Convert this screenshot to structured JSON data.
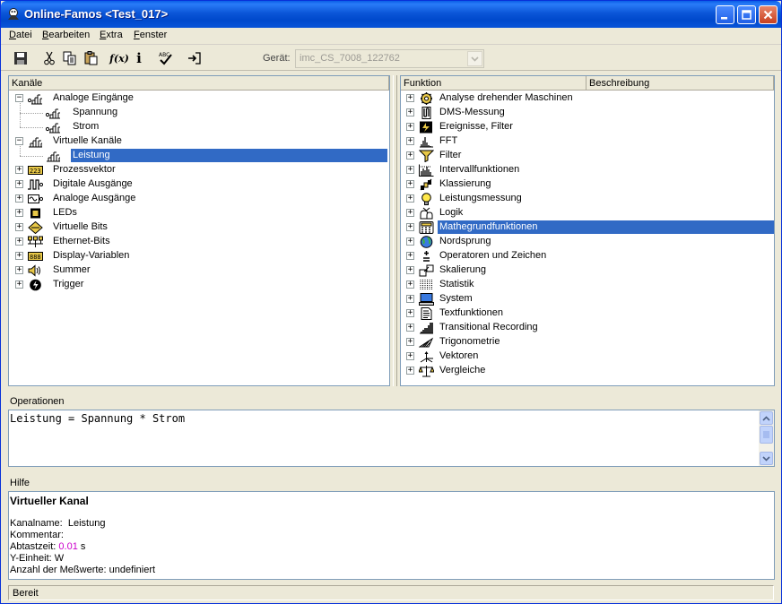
{
  "window": {
    "title": "Online-Famos <Test_017>",
    "buttons": [
      "minimize",
      "maximize",
      "close"
    ]
  },
  "menu": [
    {
      "label": "Datei",
      "u": "D",
      "rest": "atei"
    },
    {
      "label": "Bearbeiten",
      "u": "B",
      "rest": "earbeiten"
    },
    {
      "label": "Extra",
      "u": "E",
      "rest": "xtra"
    },
    {
      "label": "Fenster",
      "u": "F",
      "rest": "enster"
    }
  ],
  "toolbar": {
    "tools": [
      "save-icon",
      "cut-icon",
      "copy-icon",
      "paste-icon",
      "function-icon",
      "info-icon",
      "spellcheck-icon",
      "login-icon"
    ],
    "function_label": "f(x)",
    "info_label": "i",
    "geraet_label": "Gerät:",
    "geraet_value": "imc_CS_7008_122762"
  },
  "left_panel": {
    "header": "Kanäle",
    "items": [
      {
        "label": "Analoge Eingänge",
        "exp": "−",
        "icon": "analog-input-icon"
      },
      {
        "label": "Spannung",
        "icon": "analog-input-icon"
      },
      {
        "label": "Strom",
        "icon": "analog-input-icon"
      },
      {
        "label": "Virtuelle Kanäle",
        "exp": "−",
        "icon": "virtual-channel-icon"
      },
      {
        "label": "Leistung",
        "icon": "virtual-channel-icon",
        "selected": true
      },
      {
        "label": "Prozessvektor",
        "exp": "+",
        "icon": "process-vector-icon",
        "icon_text": "223"
      },
      {
        "label": "Digitale Ausgänge",
        "exp": "+",
        "icon": "digital-output-icon"
      },
      {
        "label": "Analoge Ausgänge",
        "exp": "+",
        "icon": "analog-output-icon"
      },
      {
        "label": "LEDs",
        "exp": "+",
        "icon": "led-icon"
      },
      {
        "label": "Virtuelle Bits",
        "exp": "+",
        "icon": "virtual-bits-icon"
      },
      {
        "label": "Ethernet-Bits",
        "exp": "+",
        "icon": "ethernet-bits-icon"
      },
      {
        "label": "Display-Variablen",
        "exp": "+",
        "icon": "display-variable-icon",
        "icon_text": "888"
      },
      {
        "label": "Summer",
        "exp": "+",
        "icon": "speaker-icon"
      },
      {
        "label": "Trigger",
        "exp": "+",
        "icon": "trigger-icon"
      }
    ]
  },
  "right_panel": {
    "headers": [
      "Funktion",
      "Beschreibung"
    ],
    "items": [
      {
        "label": "Analyse drehender Maschinen",
        "icon": "gear-icon"
      },
      {
        "label": "DMS-Messung",
        "icon": "strain-gauge-icon"
      },
      {
        "label": "Ereignisse, Filter",
        "icon": "events-icon"
      },
      {
        "label": "FFT",
        "icon": "fft-icon"
      },
      {
        "label": "Filter",
        "icon": "filter-icon"
      },
      {
        "label": "Intervallfunktionen",
        "icon": "interval-icon"
      },
      {
        "label": "Klassierung",
        "icon": "classification-icon"
      },
      {
        "label": "Leistungsmessung",
        "icon": "lightbulb-icon"
      },
      {
        "label": "Logik",
        "icon": "logic-icon"
      },
      {
        "label": "Mathegrundfunktionen",
        "icon": "calculator-icon",
        "selected": true
      },
      {
        "label": "Nordsprung",
        "icon": "globe-icon"
      },
      {
        "label": "Operatoren und Zeichen",
        "icon": "operators-icon"
      },
      {
        "label": "Skalierung",
        "icon": "scaling-icon"
      },
      {
        "label": "Statistik",
        "icon": "statistics-icon"
      },
      {
        "label": "System",
        "icon": "computer-icon"
      },
      {
        "label": "Textfunktionen",
        "icon": "document-icon"
      },
      {
        "label": "Transitional Recording",
        "icon": "recording-icon"
      },
      {
        "label": "Trigonometrie",
        "icon": "trigonometry-icon"
      },
      {
        "label": "Vektoren",
        "icon": "vectors-icon"
      },
      {
        "label": "Vergleiche",
        "icon": "scales-icon"
      }
    ]
  },
  "operations": {
    "label": "Operationen",
    "text": "Leistung = Spannung * Strom"
  },
  "help": {
    "label": "Hilfe",
    "title": "Virtueller Kanal",
    "channel_name_label": "Kanalname:",
    "channel_name": "Leistung",
    "comment_label": "Kommentar:",
    "sample_time_label": "Abtastzeit:",
    "sample_time_value": "0.01",
    "sample_time_unit": "s",
    "y_unit_label": "Y-Einheit:",
    "y_unit": "W",
    "count_label": "Anzahl der Meßwerte:",
    "count_value": "undefiniert",
    "accent_color": "#cc00cc"
  },
  "status": {
    "text": "Bereit"
  }
}
